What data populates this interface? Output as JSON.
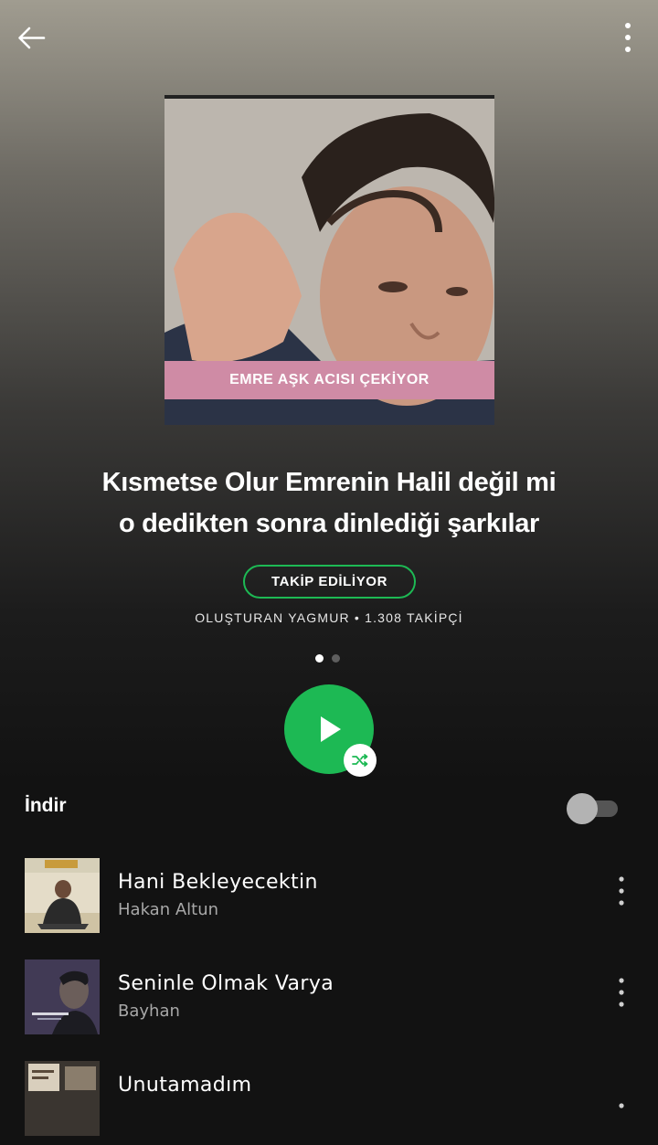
{
  "header": {
    "back_icon": "arrow-left-icon",
    "more_icon": "more-vertical-icon"
  },
  "playlist": {
    "cover_caption": "EMRE AŞK ACISI ÇEKİYOR",
    "title_line1": "Kısmetse Olur Emrenin Halil değil mi",
    "title_line2": "o dedikten sonra dinlediği şarkılar",
    "follow_label": "TAKİP EDİLİYOR",
    "owner_line": "OLUŞTURAN YAGMUR • 1.308 TAKİPÇİ",
    "pager": {
      "pages": 2,
      "active": 1
    }
  },
  "controls": {
    "play_icon": "play-icon",
    "shuffle_icon": "shuffle-icon",
    "accent_color": "#1db954"
  },
  "download": {
    "label": "İndir",
    "enabled": false
  },
  "tracks": [
    {
      "title": "Hani Bekleyecektin",
      "artist": "Hakan Altun"
    },
    {
      "title": "Seninle Olmak Varya",
      "artist": "Bayhan"
    },
    {
      "title": "Unutamadım",
      "artist": ""
    }
  ]
}
